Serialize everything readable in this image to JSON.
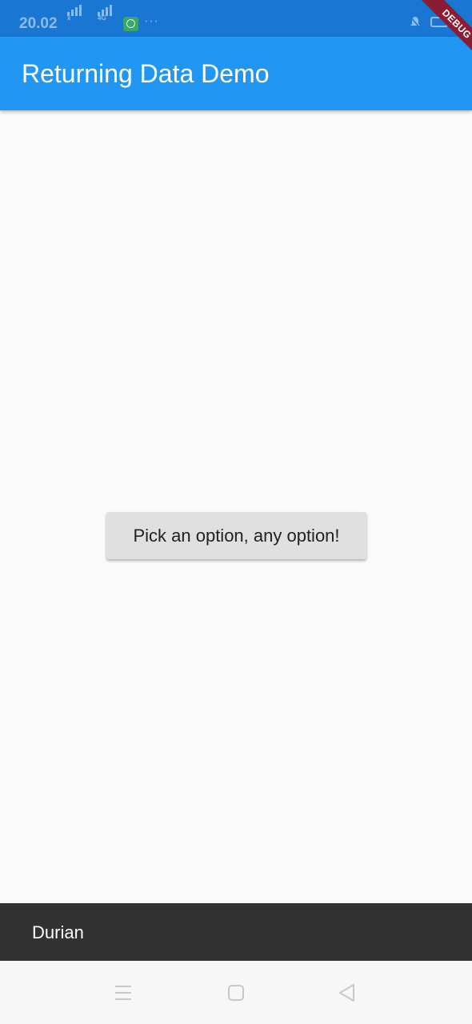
{
  "status_bar": {
    "time": "20.02",
    "signal_1_label": "x",
    "signal_2_label": "4G",
    "icons": [
      "signal-icon",
      "signal-4g-icon",
      "whatsapp-icon",
      "more-dots-icon",
      "bell-muted-icon",
      "battery-icon"
    ],
    "dots": "···"
  },
  "debug_banner": {
    "label": "DEBUG"
  },
  "app_bar": {
    "title": "Returning Data Demo"
  },
  "main": {
    "button_label": "Pick an option, any option!"
  },
  "snackbar": {
    "text": "Durian"
  },
  "nav_bar": {
    "icons": [
      "menu-icon",
      "home-square-icon",
      "back-triangle-icon"
    ]
  },
  "colors": {
    "status_bar": "#1976d2",
    "app_bar": "#2196f3",
    "background": "#fafafa",
    "button": "#e0e0e0",
    "snackbar": "#323232",
    "debug_banner": "#8a1c34"
  }
}
